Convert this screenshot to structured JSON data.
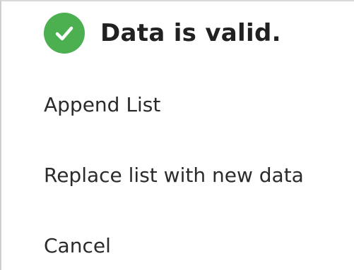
{
  "dialog": {
    "title": "Data is valid.",
    "status_icon": "check-circle-icon",
    "accent_color": "#4caf50",
    "options": [
      {
        "label": "Append List"
      },
      {
        "label": "Replace list with new data"
      },
      {
        "label": "Cancel"
      }
    ]
  }
}
